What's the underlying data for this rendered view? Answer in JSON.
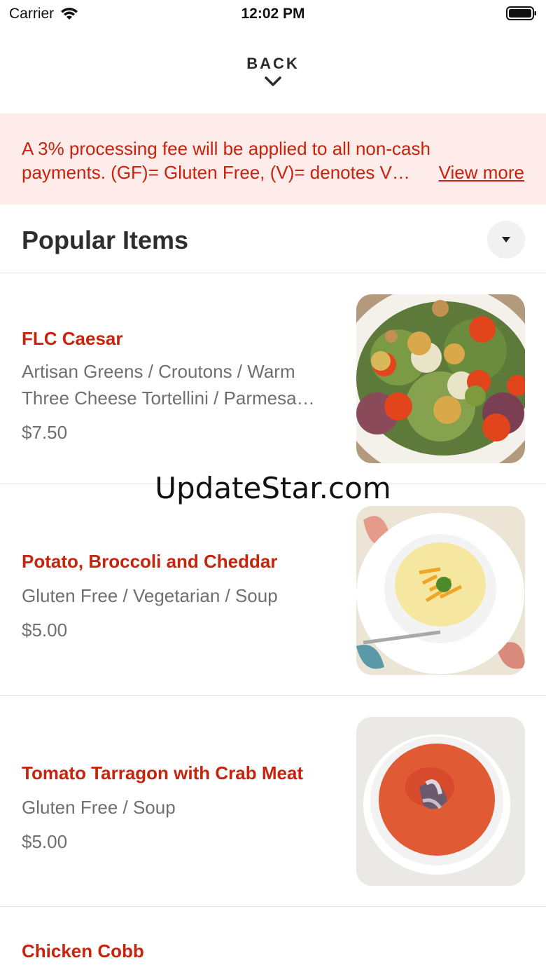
{
  "status_bar": {
    "carrier": "Carrier",
    "time": "12:02 PM"
  },
  "nav": {
    "back_label": "BACK"
  },
  "notice": {
    "line1": "A 3% processing fee will be applied to all non-cash",
    "line2": "payments. (GF)= Gluten Free, (V)= denotes V…",
    "view_more": "View more"
  },
  "section": {
    "title": "Popular Items"
  },
  "items": [
    {
      "name": "FLC Caesar",
      "desc_line1": "Artisan Greens / Croutons / Warm",
      "desc_line2": "Three Cheese Tortellini / Parmesa…",
      "price": "$7.50"
    },
    {
      "name": "Potato, Broccoli and Cheddar",
      "desc_line1": "Gluten Free / Vegetarian / Soup",
      "price": "$5.00"
    },
    {
      "name": "Tomato Tarragon with Crab Meat",
      "desc_line1": "Gluten Free / Soup",
      "price": "$5.00"
    },
    {
      "name": "Chicken Cobb"
    }
  ],
  "watermark": "UpdateStar.com",
  "colors": {
    "accent": "#c8230d",
    "notice_bg": "#fdecea",
    "muted_text": "#6f6f6f"
  }
}
